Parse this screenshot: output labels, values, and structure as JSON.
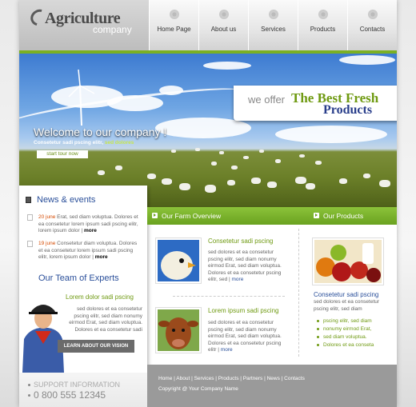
{
  "logo": {
    "title": "Agriculture",
    "subtitle": "company"
  },
  "nav": [
    {
      "label": "Home Page"
    },
    {
      "label": "About us"
    },
    {
      "label": "Services"
    },
    {
      "label": "Products"
    },
    {
      "label": "Contacts"
    }
  ],
  "hero": {
    "welcome": "Welcome to our company !",
    "sub_text": "Consetetur sadi pscing elitr, ",
    "sub_highlight": "sed dolores",
    "tour_button": "start tour now",
    "offer_prefix": "we offer",
    "offer_title": "The Best Fresh",
    "offer_products": "Products"
  },
  "news": {
    "title": "News & events",
    "items": [
      {
        "date": "20 june",
        "text": " Erat, sed diam voluptua. Dolores et ea consetetur lorem ipsum sadi pscing elitr, lorem ipsum dolor ",
        "more": "more"
      },
      {
        "date": "19 june",
        "text": " Consetetur diam voluptua. Dolores et ea consetetur lorem ipsum sadi pscing elitr, lorem ipsum dolor ",
        "more": "more"
      }
    ]
  },
  "team": {
    "title": "Our Team of Experts",
    "subtitle": "Lorem dolor sadi pscing",
    "text": "sed dolores et ea consetetur pscing elitr, sed diam nonumy eirmod Erat, sed diam voluptua. Dolores et ea consetetur sadi",
    "button": "LEARN ABOUT OUR VISION"
  },
  "overview": {
    "title": "Our Farm Overview",
    "items": [
      {
        "heading": "Consetetur sadi pscing",
        "text": "sed dolores et ea consetetur pscing elitr, sed diam nonumy eirmod Erat, sed diam voluptua. Dolores et ea consetetur pscing elitr, sed ",
        "more": "more"
      },
      {
        "heading": "Lorem ipsum sadi pscing",
        "text": "sed dolores et ea consetetur pscing elitr, sed diam nonumy eirmod Erat, sed diam voluptua. Dolores et ea consetetur pscing elitr ",
        "more": "more"
      }
    ]
  },
  "products": {
    "title": "Our Products",
    "heading": "Consetetur sadi pscing",
    "text": "sed dolores et ea consetetur pscing elitr, sed diam",
    "list": [
      "pscing elitr, sed diam",
      "nonumy eirmod Erat,",
      "sed diam voluptua.",
      "Dolores et ea conseta"
    ]
  },
  "footer": {
    "links": "Home | About | Services | Products | Partners | News | Contacts",
    "copyright": "Copyright @ Your Company Name"
  },
  "support": {
    "label": "SUPPORT INFORMATION",
    "phone": "0 800 555 12345"
  },
  "colors": {
    "accent_green": "#7ab024",
    "heading_blue": "#2a4f9a",
    "date_orange": "#d54a00"
  }
}
